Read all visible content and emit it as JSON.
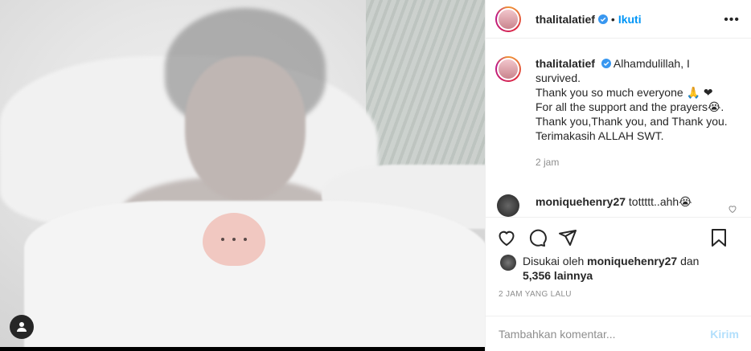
{
  "post": {
    "username": "thalitalatief",
    "follow_label": "Ikuti",
    "separator": "•",
    "more_label": "•••"
  },
  "caption": {
    "username": "thalitalatief",
    "lines": [
      "Alhamdulillah, I",
      "survived.",
      "Thank you so much everyone 🙏 ❤",
      "For all the support and the prayers😭.",
      "Thank you,Thank you, and Thank you.",
      "Terimakasih ALLAH SWT."
    ],
    "time": "2 jam"
  },
  "comment": {
    "username": "moniquehenry27",
    "text": "tottttt..ahh😭"
  },
  "likes": {
    "prefix": "Disukai oleh",
    "user": "moniquehenry27",
    "joiner": "dan",
    "count": "5,356 lainnya"
  },
  "timestamp": "2 JAM YANG LALU",
  "add_comment": {
    "placeholder": "Tambahkan komentar...",
    "post_label": "Kirim"
  },
  "colors": {
    "link_blue": "#0095f6",
    "post_disabled": "#b2dffc",
    "secondary_text": "#8e8e8e"
  }
}
